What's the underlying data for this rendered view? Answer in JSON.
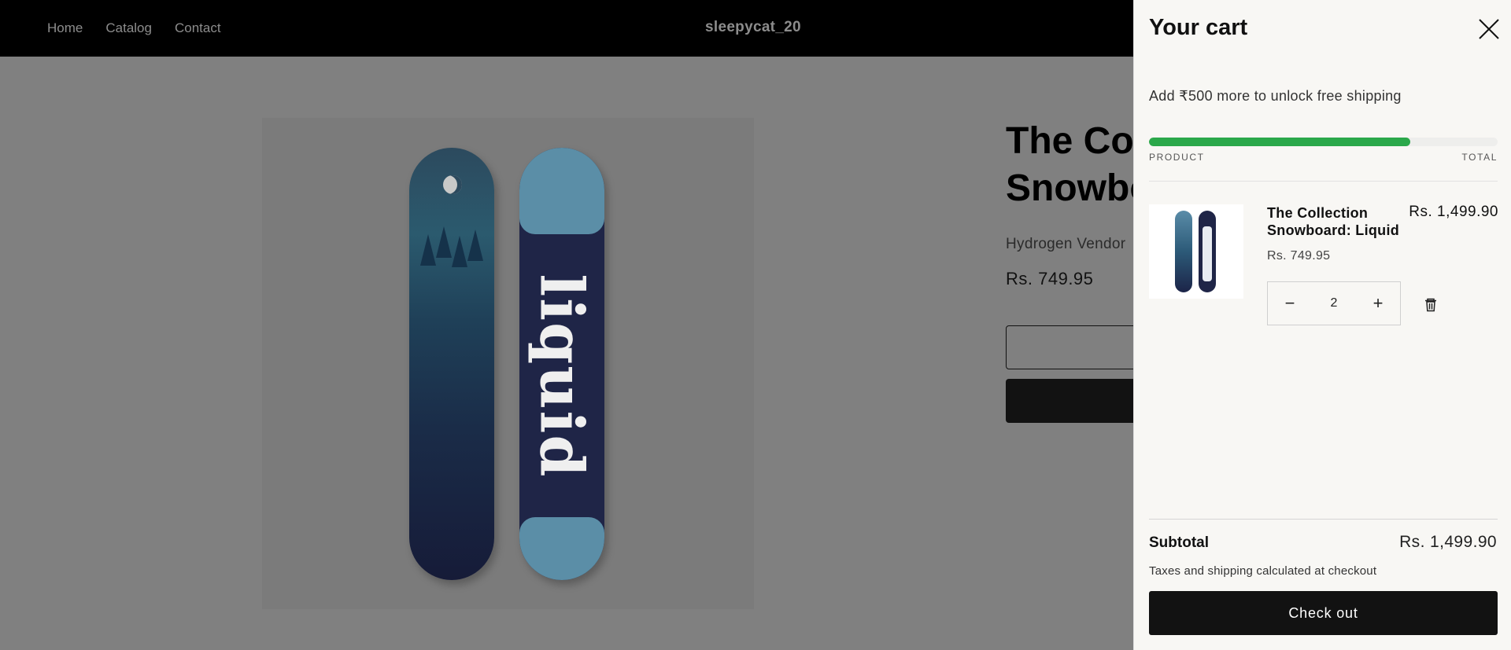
{
  "header": {
    "nav": [
      "Home",
      "Catalog",
      "Contact"
    ],
    "brand": "sleepycat_20"
  },
  "product": {
    "title": "The Collection Snowboard: Liquid",
    "vendor": "Hydrogen Vendor",
    "price": "Rs. 749.95",
    "image_board_text": "liquid"
  },
  "cart": {
    "title": "Your cart",
    "shipping_message": "Add ₹500 more to unlock free shipping",
    "shipping_progress": 0.75,
    "columns": {
      "product": "PRODUCT",
      "total": "TOTAL"
    },
    "items": [
      {
        "name": "The Collection Snowboard: Liquid",
        "unit_price": "Rs. 749.95",
        "line_total": "Rs. 1,499.90",
        "quantity": "2",
        "decrease_symbol": "−",
        "increase_symbol": "+"
      }
    ],
    "subtotal_label": "Subtotal",
    "subtotal_value": "Rs. 1,499.90",
    "tax_note": "Taxes and shipping calculated at checkout",
    "checkout_label": "Check out",
    "accent_color": "#2ba84a"
  }
}
